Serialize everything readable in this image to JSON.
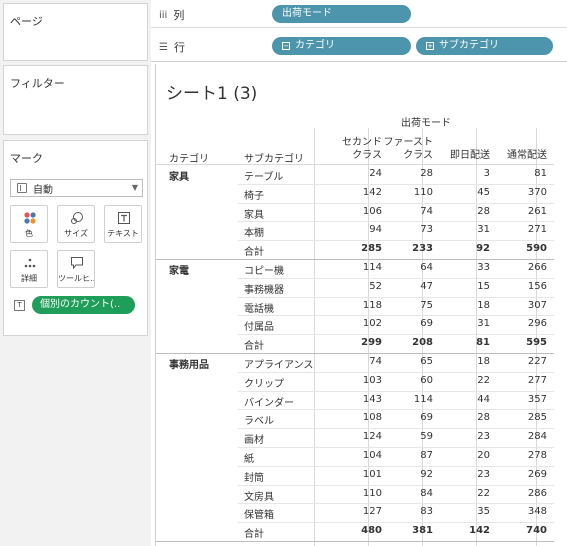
{
  "left_panel": {
    "pages_title": "ページ",
    "filters_title": "フィルター",
    "marks": {
      "title": "マーク",
      "mark_type": "自動",
      "buttons": [
        {
          "label": "色",
          "icon": "color-icon"
        },
        {
          "label": "サイズ",
          "icon": "size-icon"
        },
        {
          "label": "テキスト",
          "icon": "text-icon"
        },
        {
          "label": "詳細",
          "icon": "detail-icon"
        },
        {
          "label": "ツールヒ…",
          "icon": "tooltip-icon"
        }
      ],
      "pill_label": "個別のカウント(.."
    }
  },
  "shelves": {
    "columns_label": "列",
    "rows_label": "行",
    "column_pill": "出荷モード",
    "row_pills": [
      "カテゴリ",
      "サブカテゴリ"
    ]
  },
  "sheet": {
    "title": "シート1 (3)",
    "column_group_header": "出荷モード",
    "headers": {
      "category": "カテゴリ",
      "subcategory": "サブカテゴリ",
      "columns": [
        "セカンド\nクラス",
        "ファースト\nクラス",
        "即日配送",
        "通常配送"
      ]
    },
    "rows": [
      {
        "cat": "家具",
        "sub": "テーブル",
        "values": [
          24,
          28,
          3,
          81
        ]
      },
      {
        "cat": "",
        "sub": "椅子",
        "values": [
          142,
          110,
          45,
          370
        ]
      },
      {
        "cat": "",
        "sub": "家具",
        "values": [
          106,
          74,
          28,
          261
        ]
      },
      {
        "cat": "",
        "sub": "本棚",
        "values": [
          94,
          73,
          31,
          271
        ]
      },
      {
        "cat": "",
        "sub": "合計",
        "values": [
          285,
          233,
          92,
          590
        ],
        "total": true
      },
      {
        "cat": "家電",
        "sub": "コピー機",
        "values": [
          114,
          64,
          33,
          266
        ]
      },
      {
        "cat": "",
        "sub": "事務機器",
        "values": [
          52,
          47,
          15,
          156
        ]
      },
      {
        "cat": "",
        "sub": "電話機",
        "values": [
          118,
          75,
          18,
          307
        ]
      },
      {
        "cat": "",
        "sub": "付属品",
        "values": [
          102,
          69,
          31,
          296
        ]
      },
      {
        "cat": "",
        "sub": "合計",
        "values": [
          299,
          208,
          81,
          595
        ],
        "total": true
      },
      {
        "cat": "事務用品",
        "sub": "アプライアンス",
        "values": [
          74,
          65,
          18,
          227
        ]
      },
      {
        "cat": "",
        "sub": "クリップ",
        "values": [
          103,
          60,
          22,
          277
        ]
      },
      {
        "cat": "",
        "sub": "バインダー",
        "values": [
          143,
          114,
          44,
          357
        ]
      },
      {
        "cat": "",
        "sub": "ラベル",
        "values": [
          108,
          69,
          28,
          285
        ]
      },
      {
        "cat": "",
        "sub": "画材",
        "values": [
          124,
          59,
          23,
          284
        ]
      },
      {
        "cat": "",
        "sub": "紙",
        "values": [
          104,
          87,
          20,
          278
        ]
      },
      {
        "cat": "",
        "sub": "封筒",
        "values": [
          101,
          92,
          23,
          269
        ]
      },
      {
        "cat": "",
        "sub": "文房具",
        "values": [
          110,
          84,
          22,
          286
        ]
      },
      {
        "cat": "",
        "sub": "保管箱",
        "values": [
          127,
          83,
          35,
          348
        ]
      },
      {
        "cat": "",
        "sub": "合計",
        "values": [
          480,
          381,
          142,
          740
        ],
        "total": true
      }
    ]
  }
}
